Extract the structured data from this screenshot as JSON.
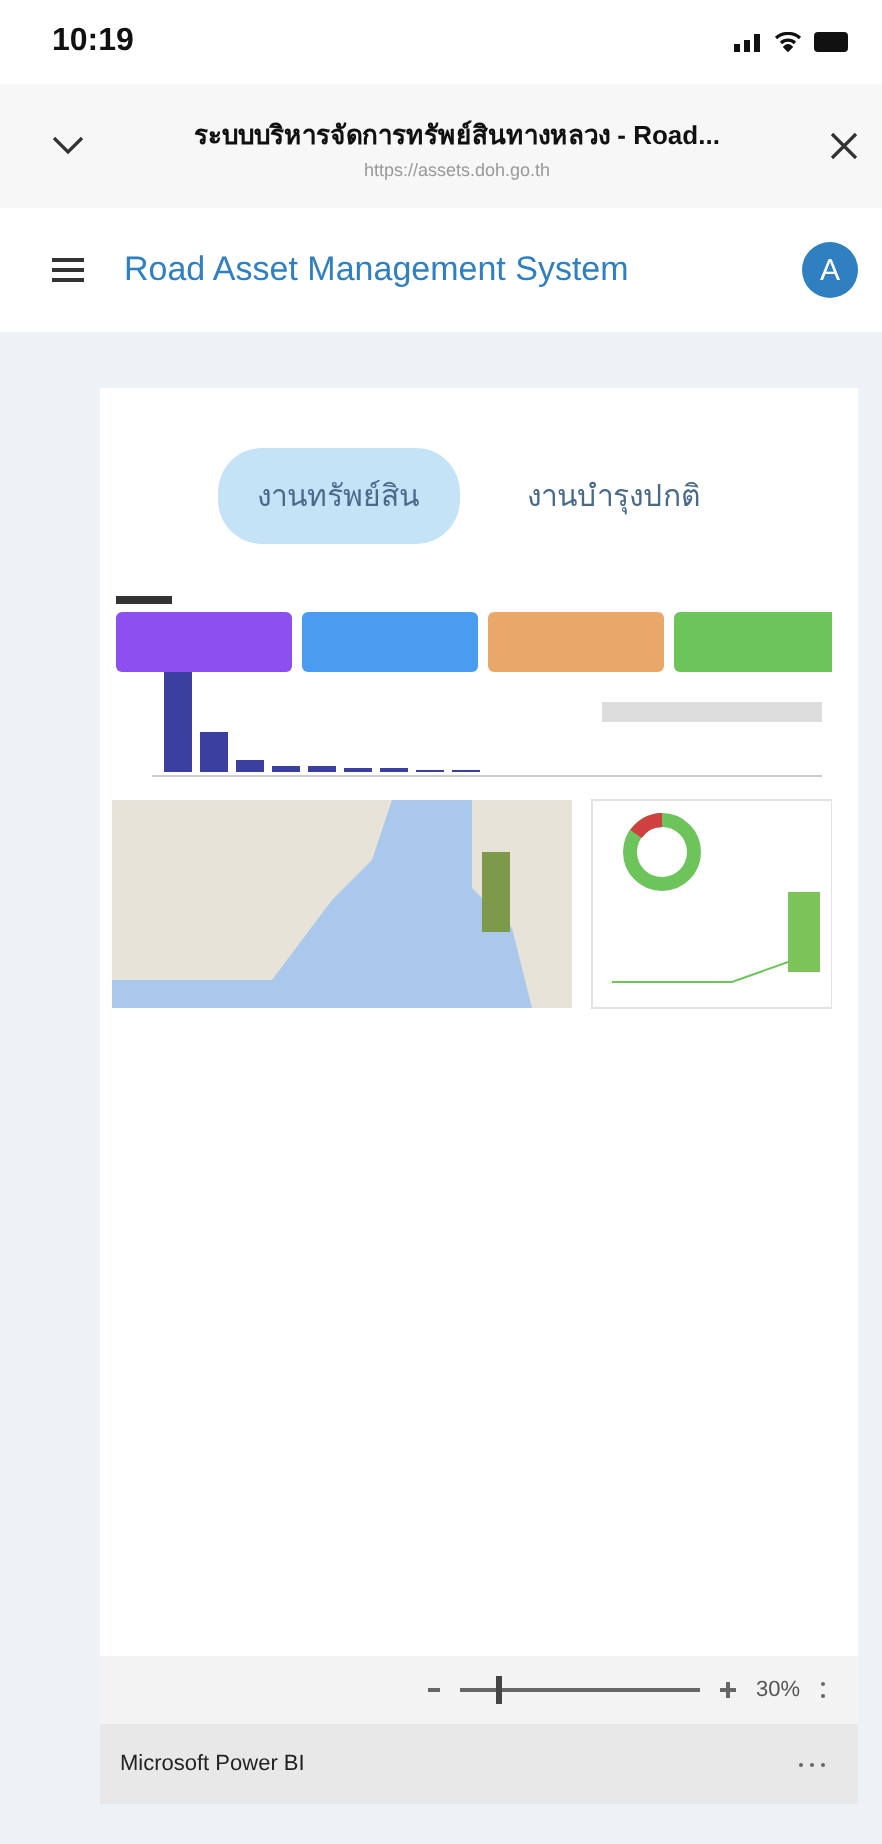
{
  "status_bar": {
    "time": "10:19"
  },
  "browser": {
    "title": "ระบบบริหารจัดการทรัพย์สินทางหลวง - Road...",
    "url": "https://assets.doh.go.th"
  },
  "app_bar": {
    "title": "Road Asset Management System",
    "avatar": "A"
  },
  "tabs": [
    {
      "label": "งานทรัพย์สิน",
      "selected": true
    },
    {
      "label": "งานบำรุงปกติ",
      "selected": false
    }
  ],
  "report_toolbar": {
    "zoom": {
      "level": 0.15
    },
    "zoom_reading": "30%"
  },
  "footer": {
    "label": "Microsoft Power BI"
  }
}
